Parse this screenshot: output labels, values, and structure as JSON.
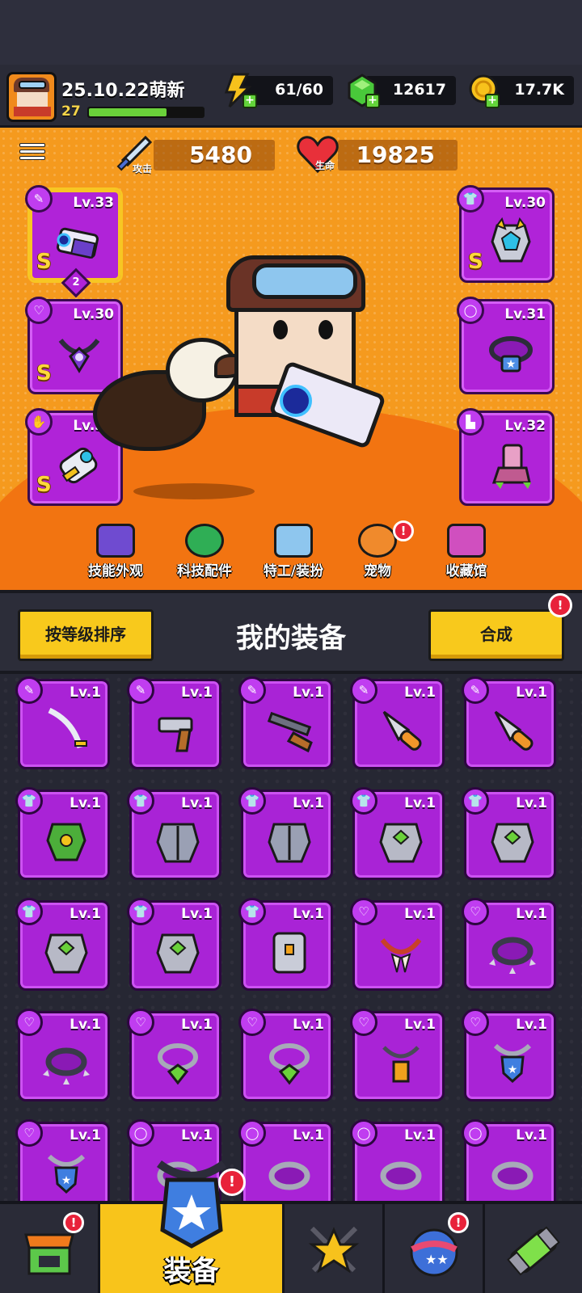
{
  "player": {
    "name": "25.10.22萌新",
    "level": "27",
    "xp_fraction": 0.68
  },
  "resources": {
    "energy": "61/60",
    "gems": "12617",
    "coins": "17.7K"
  },
  "stats": {
    "attack_label": "攻击",
    "attack": "5480",
    "hp_label": "生命",
    "hp": "19825"
  },
  "equipped": {
    "weapon": {
      "lv": "Lv.33",
      "rank": "S",
      "stars": "2",
      "icon": "weapon-icon"
    },
    "armor": {
      "lv": "Lv.30",
      "rank": "S",
      "icon": "armor-icon"
    },
    "necklace": {
      "lv": "Lv.30",
      "rank": "S",
      "icon": "necklace-icon"
    },
    "ring": {
      "lv": "Lv.31",
      "icon": "ring-icon"
    },
    "gloves": {
      "lv": "Lv.31",
      "rank": "S",
      "icon": "glove-icon"
    },
    "boots": {
      "lv": "Lv.32",
      "icon": "boot-icon"
    }
  },
  "categories": [
    {
      "label": "技能外观",
      "icon": "skill-skin-icon"
    },
    {
      "label": "科技配件",
      "icon": "tech-part-icon"
    },
    {
      "label": "特工/装扮",
      "icon": "agent-icon"
    },
    {
      "label": "宠物",
      "icon": "pet-icon"
    },
    {
      "label": "收藏馆",
      "icon": "collection-icon"
    }
  ],
  "inventory": {
    "sort_label": "按等级排序",
    "title": "我的装备",
    "merge_label": "合成",
    "items": [
      {
        "lv": "Lv.1",
        "type": "weapon",
        "icon": "katana-icon"
      },
      {
        "lv": "Lv.1",
        "type": "weapon",
        "icon": "revolver-icon"
      },
      {
        "lv": "Lv.1",
        "type": "weapon",
        "icon": "shotgun-icon"
      },
      {
        "lv": "Lv.1",
        "type": "weapon",
        "icon": "spear-icon"
      },
      {
        "lv": "Lv.1",
        "type": "weapon",
        "icon": "spear-icon"
      },
      {
        "lv": "Lv.1",
        "type": "armor",
        "icon": "leaf-armor-icon"
      },
      {
        "lv": "Lv.1",
        "type": "armor",
        "icon": "steel-armor-icon"
      },
      {
        "lv": "Lv.1",
        "type": "armor",
        "icon": "steel-armor-icon"
      },
      {
        "lv": "Lv.1",
        "type": "armor",
        "icon": "gem-armor-icon"
      },
      {
        "lv": "Lv.1",
        "type": "armor",
        "icon": "gem-armor-icon"
      },
      {
        "lv": "Lv.1",
        "type": "armor",
        "icon": "gem-armor-icon"
      },
      {
        "lv": "Lv.1",
        "type": "armor",
        "icon": "gem-armor-icon"
      },
      {
        "lv": "Lv.1",
        "type": "armor",
        "icon": "tech-armor-icon"
      },
      {
        "lv": "Lv.1",
        "type": "necklace",
        "icon": "fang-necklace-icon"
      },
      {
        "lv": "Lv.1",
        "type": "necklace",
        "icon": "spiked-collar-icon"
      },
      {
        "lv": "Lv.1",
        "type": "necklace",
        "icon": "spiked-collar-icon"
      },
      {
        "lv": "Lv.1",
        "type": "necklace",
        "icon": "emerald-necklace-icon"
      },
      {
        "lv": "Lv.1",
        "type": "necklace",
        "icon": "emerald-necklace-icon"
      },
      {
        "lv": "Lv.1",
        "type": "necklace",
        "icon": "lantern-necklace-icon"
      },
      {
        "lv": "Lv.1",
        "type": "necklace",
        "icon": "shield-necklace-icon"
      },
      {
        "lv": "Lv.1",
        "type": "necklace",
        "icon": "shield-necklace-icon"
      },
      {
        "lv": "Lv.1",
        "type": "ring",
        "icon": "ring-icon"
      },
      {
        "lv": "Lv.1",
        "type": "ring",
        "icon": "ring-icon"
      },
      {
        "lv": "Lv.1",
        "type": "ring",
        "icon": "ring-icon"
      },
      {
        "lv": "Lv.1",
        "type": "ring",
        "icon": "ring-icon"
      }
    ]
  },
  "nav": [
    {
      "label": "",
      "icon": "shop-icon",
      "alert": "!"
    },
    {
      "label": "装备",
      "icon": "equipment-icon",
      "alert": "!"
    },
    {
      "label": "",
      "icon": "talent-star-icon"
    },
    {
      "label": "",
      "icon": "lottery-egg-icon",
      "alert": "!"
    },
    {
      "label": "",
      "icon": "gene-capsule-icon"
    }
  ],
  "colors": {
    "purple_rarity": "#a923d6",
    "orange_bg": "#f59a1e",
    "accent_yellow": "#f8c91c",
    "alert_red": "#e8223a"
  }
}
